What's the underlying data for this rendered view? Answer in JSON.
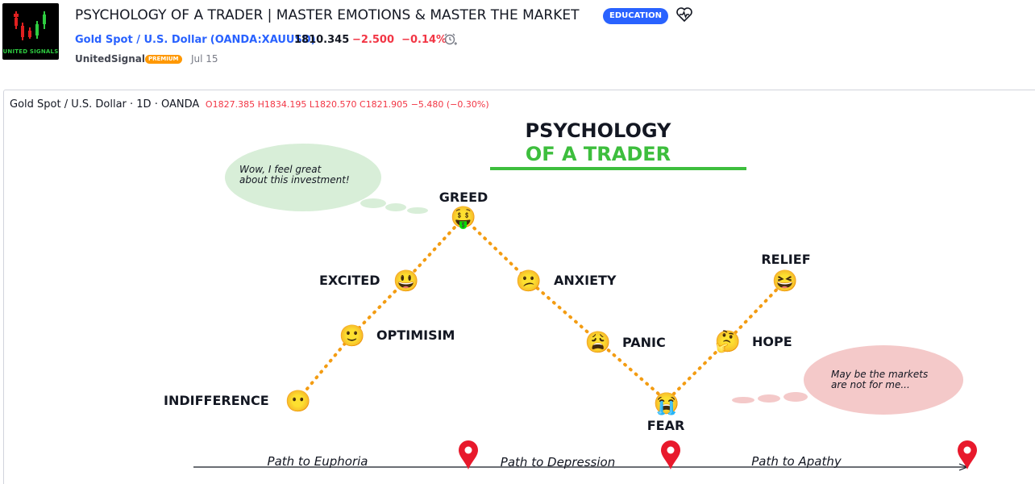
{
  "header": {
    "logo_text": "UNITED SIGNALS",
    "title": "PSYCHOLOGY OF A TRADER | MASTER EMOTIONS & MASTER THE MARKET",
    "category_badge": "EDUCATION",
    "symbol_name": "Gold Spot / U.S. Dollar",
    "symbol_ticker": "OANDA:XAUUSD",
    "price": "1810.345",
    "change": "−2.500",
    "change_pct": "−0.14%",
    "author": "UnitedSignals",
    "author_badge": "PREMIUM",
    "date": "Jul 15"
  },
  "chart": {
    "legend_symbol": "Gold Spot / U.S. Dollar · 1D · OANDA",
    "open_label": "O",
    "open": "1827.385",
    "high_label": "H",
    "high": "1834.195",
    "low_label": "L",
    "low": "1820.570",
    "close_label": "C",
    "close": "1821.905",
    "change": "−5.480 (−0.30%)"
  },
  "drawing": {
    "headline_line1": "PSYCHOLOGY",
    "headline_line2": "OF A TRADER",
    "stages": [
      {
        "label": "INDIFFERENCE",
        "emoji": "😶"
      },
      {
        "label": "OPTIMISIM",
        "emoji": "🙂"
      },
      {
        "label": "EXCITED",
        "emoji": "😃"
      },
      {
        "label": "GREED",
        "emoji": "🤑"
      },
      {
        "label": "ANXIETY",
        "emoji": "😕"
      },
      {
        "label": "PANIC",
        "emoji": "😩"
      },
      {
        "label": "FEAR",
        "emoji": "😭"
      },
      {
        "label": "HOPE",
        "emoji": "🤔"
      },
      {
        "label": "RELIEF",
        "emoji": "😆"
      }
    ],
    "bubble_top": [
      "Wow, I feel great",
      "about this investment!"
    ],
    "bubble_bottom": [
      "May be the markets",
      "are not for me..."
    ],
    "paths": [
      "Path to Euphoria",
      "Path to Depression",
      "Path to Apathy"
    ]
  },
  "colors": {
    "accent_green": "#3dbe3d",
    "dotted_line": "#f39c12",
    "bubble_green": "#d8eed8",
    "bubble_pink": "#f4c9c9",
    "marker_red": "#e8192c",
    "negative": "#f23645",
    "link_blue": "#2962ff"
  }
}
